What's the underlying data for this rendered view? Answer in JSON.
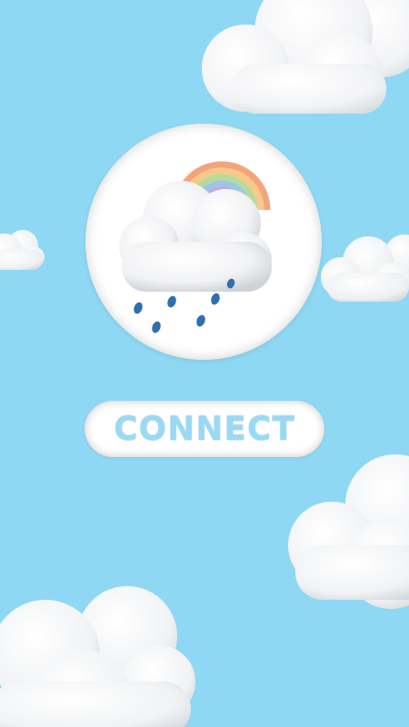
{
  "screen": {
    "background_color": "#8fd8f3"
  },
  "logo": {
    "icon": "rain-cloud-rainbow-icon",
    "rainbow_colors": [
      "#f4a47a",
      "#f7c98a",
      "#b9d99a",
      "#9cc6e6",
      "#c4a6de"
    ],
    "raindrop_color": "#2f6fb0"
  },
  "connect_button": {
    "label": "CONNECT",
    "text_color": "#9ad9f3"
  },
  "decorations": {
    "clouds": [
      "cloud-icon",
      "cloud-icon",
      "cloud-icon",
      "cloud-icon",
      "cloud-icon"
    ]
  }
}
